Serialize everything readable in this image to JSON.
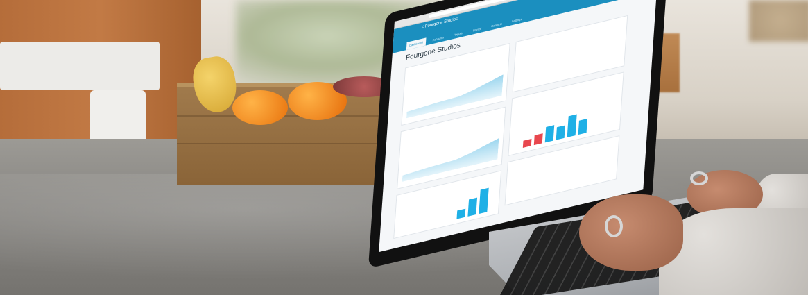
{
  "photo": {
    "subject": "laptop-on-kitchen-counter",
    "screen": {
      "app_name": "< Fourgone Studios",
      "page_title": "Fourgone Studios",
      "tabs": [
        {
          "label": "Dashboard",
          "active": true
        },
        {
          "label": "Accounts",
          "active": false
        },
        {
          "label": "Reports",
          "active": false
        },
        {
          "label": "Payroll",
          "active": false
        },
        {
          "label": "Contacts",
          "active": false
        },
        {
          "label": "Settings",
          "active": false
        }
      ],
      "accent_color": "#1b8fbf",
      "bar_colors": {
        "positive": "#1fb0e6",
        "negative": "#e8474e"
      }
    }
  }
}
